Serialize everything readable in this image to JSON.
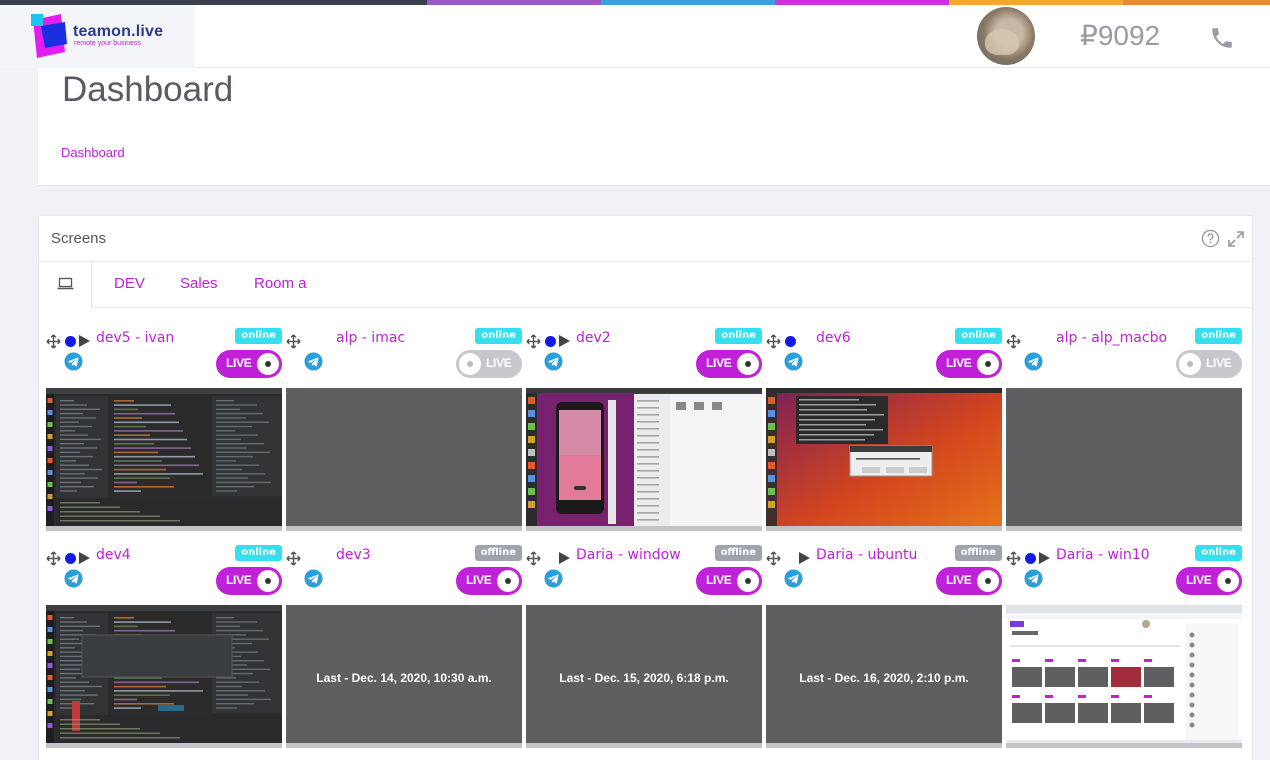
{
  "app": {
    "logo_name": "teamon.live",
    "logo_tagline": "remote your business",
    "balance": "₽9092",
    "stripe_colors": [
      "#3a3f4e",
      "#3a3f4e",
      "#9b59c6",
      "#3aa0e0",
      "#d02fe0",
      "#f3a92a",
      "#e88a30"
    ]
  },
  "header": {
    "title": "Dashboard",
    "breadcrumb": "Dashboard"
  },
  "screens": {
    "title": "Screens",
    "tabs": [
      "DEV",
      "Sales",
      "Room a"
    ],
    "status_labels": {
      "online": "online",
      "offline": "offline"
    },
    "live_label": "LIVE",
    "tiles": [
      {
        "name": "dev5 - ivan",
        "status": "online",
        "dot": true,
        "play": true,
        "live": true,
        "thumb": "ide-dark",
        "caption": ""
      },
      {
        "name": "alp - imac",
        "status": "online",
        "dot": false,
        "play": false,
        "live": false,
        "thumb": "blank",
        "caption": ""
      },
      {
        "name": "dev2",
        "status": "online",
        "dot": true,
        "play": true,
        "live": true,
        "thumb": "ubuntu-android",
        "caption": ""
      },
      {
        "name": "dev6",
        "status": "online",
        "dot": true,
        "play": false,
        "live": true,
        "thumb": "ubuntu-orange",
        "caption": ""
      },
      {
        "name": "alp - alp_macbo",
        "status": "online",
        "dot": false,
        "play": false,
        "live": false,
        "thumb": "blank",
        "caption": ""
      },
      {
        "name": "dev4",
        "status": "online",
        "dot": true,
        "play": true,
        "live": true,
        "thumb": "ide-dark2",
        "caption": ""
      },
      {
        "name": "dev3",
        "status": "offline",
        "dot": false,
        "play": false,
        "live": true,
        "thumb": "blank",
        "caption": "Last - Dec. 14, 2020, 10:30 a.m."
      },
      {
        "name": "Daria - window",
        "status": "offline",
        "dot": false,
        "play": true,
        "live": true,
        "thumb": "blank",
        "caption": "Last - Dec. 15, 2020, 6:18 p.m."
      },
      {
        "name": "Daria - ubuntu",
        "status": "offline",
        "dot": false,
        "play": true,
        "live": true,
        "thumb": "blank",
        "caption": "Last - Dec. 16, 2020, 2:10 p.m."
      },
      {
        "name": "Daria - win10",
        "status": "online",
        "dot": true,
        "play": true,
        "live": true,
        "thumb": "browser-light",
        "caption": ""
      }
    ]
  }
}
